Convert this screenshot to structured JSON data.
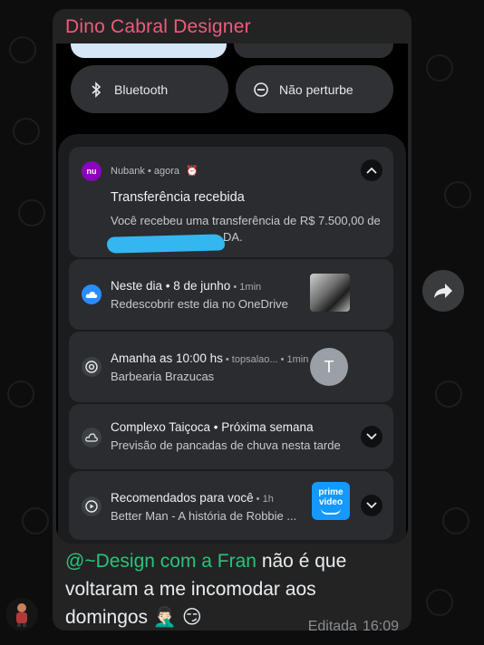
{
  "chat": {
    "sender_name": "Dino Cabral Designer",
    "caption_mention": "@~Design com a Fran",
    "caption_text": " não é que voltaram a me incomodar aos domingos 🤦🏻‍♂️ 😏",
    "edited_label": "Editada",
    "time": "16:09"
  },
  "quick_settings": {
    "bluetooth_label": "Bluetooth",
    "dnd_label": "Não perturbe"
  },
  "notifications": [
    {
      "app": "Nubank",
      "meta": " • agora",
      "title": "Transferência recebida",
      "body_line1": "Você recebeu uma transferência de R$ 7.500,00 de",
      "body_line2": "DA."
    },
    {
      "title": "Neste dia • 8 de junho",
      "meta": " • 1min",
      "body": "Redescobrir este dia no OneDrive"
    },
    {
      "title": "Amanha as 10:00 hs",
      "meta": " • topsalao... • 1min",
      "body": "Barbearia Brazucas",
      "avatar_letter": "T"
    },
    {
      "title": "Complexo Taiçoca • Próxima semana",
      "body": "Previsão de pancadas de chuva nesta tarde"
    },
    {
      "title": "Recomendados para você",
      "meta": " • 1h",
      "body": "Better Man - A história de Robbie ...",
      "badge_line1": "prime",
      "badge_line2": "video"
    }
  ],
  "colors": {
    "sender": "#f05a7a",
    "mention": "#28c47a",
    "nubank": "#8a05be",
    "onedrive": "#2a8cff",
    "prime": "#1399ff"
  },
  "icons": {
    "forward": "forward-arrow-icon",
    "bluetooth": "bluetooth-icon",
    "dnd": "do-not-disturb-icon"
  }
}
